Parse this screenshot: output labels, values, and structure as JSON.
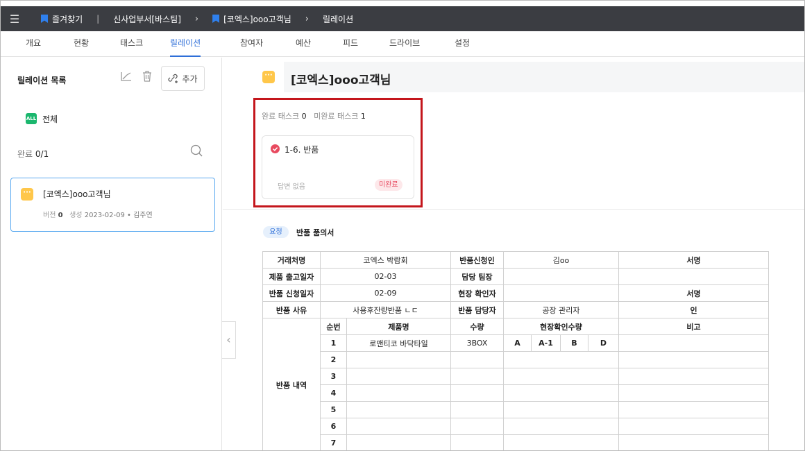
{
  "topbar": {
    "favorites": "즐겨찾기",
    "dept": "신사업부서[바스팀]",
    "project": "[코엑스]ooo고객님",
    "current": "릴레이션"
  },
  "tabs": [
    "개요",
    "현황",
    "태스크",
    "릴레이션",
    "참여자",
    "예산",
    "피드",
    "드라이브",
    "설정"
  ],
  "sidebar": {
    "title": "릴레이션 목록",
    "add_label": "추가",
    "all_badge": "ALL",
    "all_label": "전체",
    "done_prefix": "완료",
    "done_value": "0/1",
    "item": {
      "title": "[코엑스]ooo고객님",
      "version_label": "버전",
      "version": "0",
      "created_label": "생성",
      "created": "2023-02-09 • 김주연"
    }
  },
  "main": {
    "title": "[코엑스]ooo고객님",
    "done_tasks_label": "완료 태스크",
    "done_tasks": "0",
    "undone_tasks_label": "미완료 태스크",
    "undone_tasks": "1",
    "task": {
      "name": "1-6. 반품",
      "answer": "답변 없음",
      "status": "미완료"
    },
    "request_badge": "요청",
    "request_title": "반품 품의서"
  },
  "form": {
    "r1": [
      "거래처명",
      "코엑스 박람회",
      "반품신청인",
      "김oo",
      "서명"
    ],
    "r2": [
      "제품 출고일자",
      "02-03",
      "담당 팀장",
      "",
      ""
    ],
    "r3": [
      "반품 신청일자",
      "02-09",
      "현장 확인자",
      "",
      "서명"
    ],
    "r4": [
      "반품 사유",
      "사용후잔량반품 ㄴㄷ",
      "반품 담당자",
      "공장 관리자",
      "인"
    ],
    "detail_label": "반품 내역",
    "headers": [
      "순번",
      "제품명",
      "수량",
      "현장확인수량",
      "비고"
    ],
    "sub": [
      "A",
      "A-1",
      "B",
      "D"
    ],
    "rows": [
      [
        "1",
        "로맨티코 바닥타일",
        "3BOX"
      ],
      [
        "2",
        "",
        ""
      ],
      [
        "3",
        "",
        ""
      ],
      [
        "4",
        "",
        ""
      ],
      [
        "5",
        "",
        ""
      ],
      [
        "6",
        "",
        ""
      ],
      [
        "7",
        "",
        ""
      ]
    ]
  }
}
